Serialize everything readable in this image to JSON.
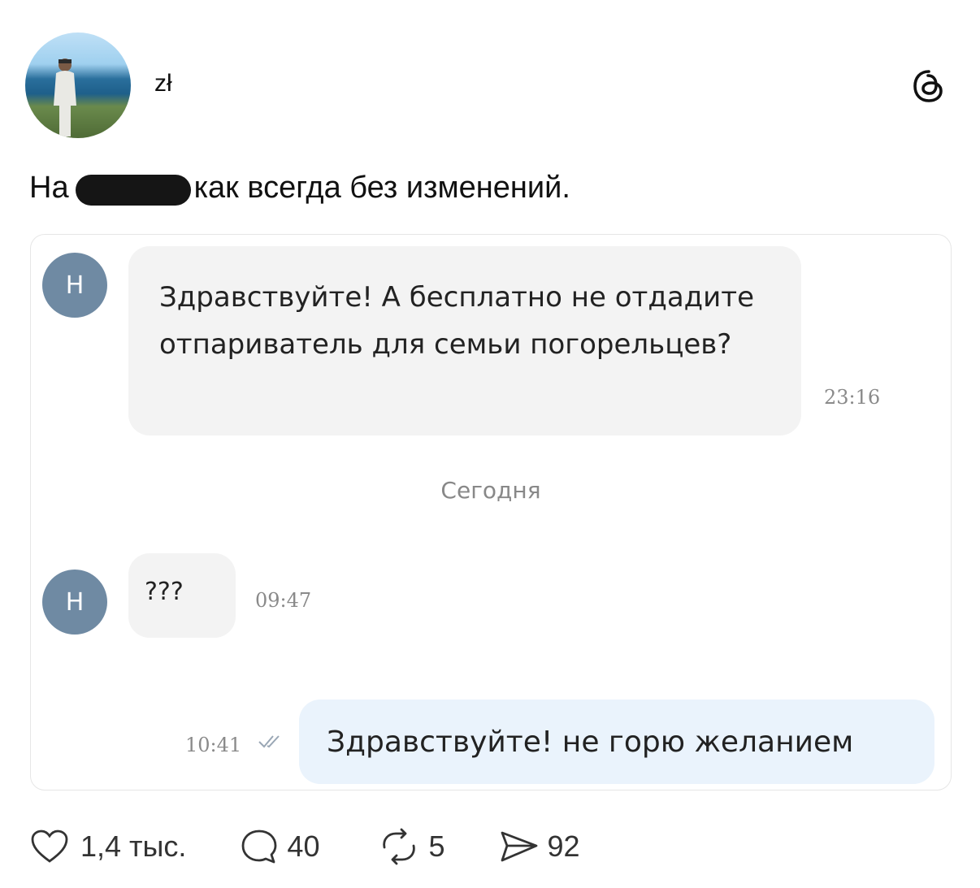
{
  "post": {
    "author": "zł",
    "text_before": "На",
    "text_after": "как всегда без изменений."
  },
  "chat": {
    "avatar_letter": "Н",
    "message_1": {
      "text": "Здравствуйте! А бесплатно не отдадите отпариватель для семьи погорельцев?",
      "time": "23:16"
    },
    "date_divider": "Сегодня",
    "message_2": {
      "text": "???",
      "time": "09:47"
    },
    "message_3": {
      "text": "Здравствуйте! не горю желанием",
      "time": "10:41"
    }
  },
  "actions": {
    "likes": "1,4 тыс.",
    "comments": "40",
    "reposts": "5",
    "shares": "92"
  },
  "icons": {
    "like": "heart-icon",
    "comment": "comment-icon",
    "repost": "repost-icon",
    "share": "send-icon",
    "brand": "threads-logo-icon"
  },
  "colors": {
    "avatar_h": "#6f8aa3",
    "incoming_bubble": "#f3f3f3",
    "outgoing_bubble": "#eaf3fc"
  }
}
